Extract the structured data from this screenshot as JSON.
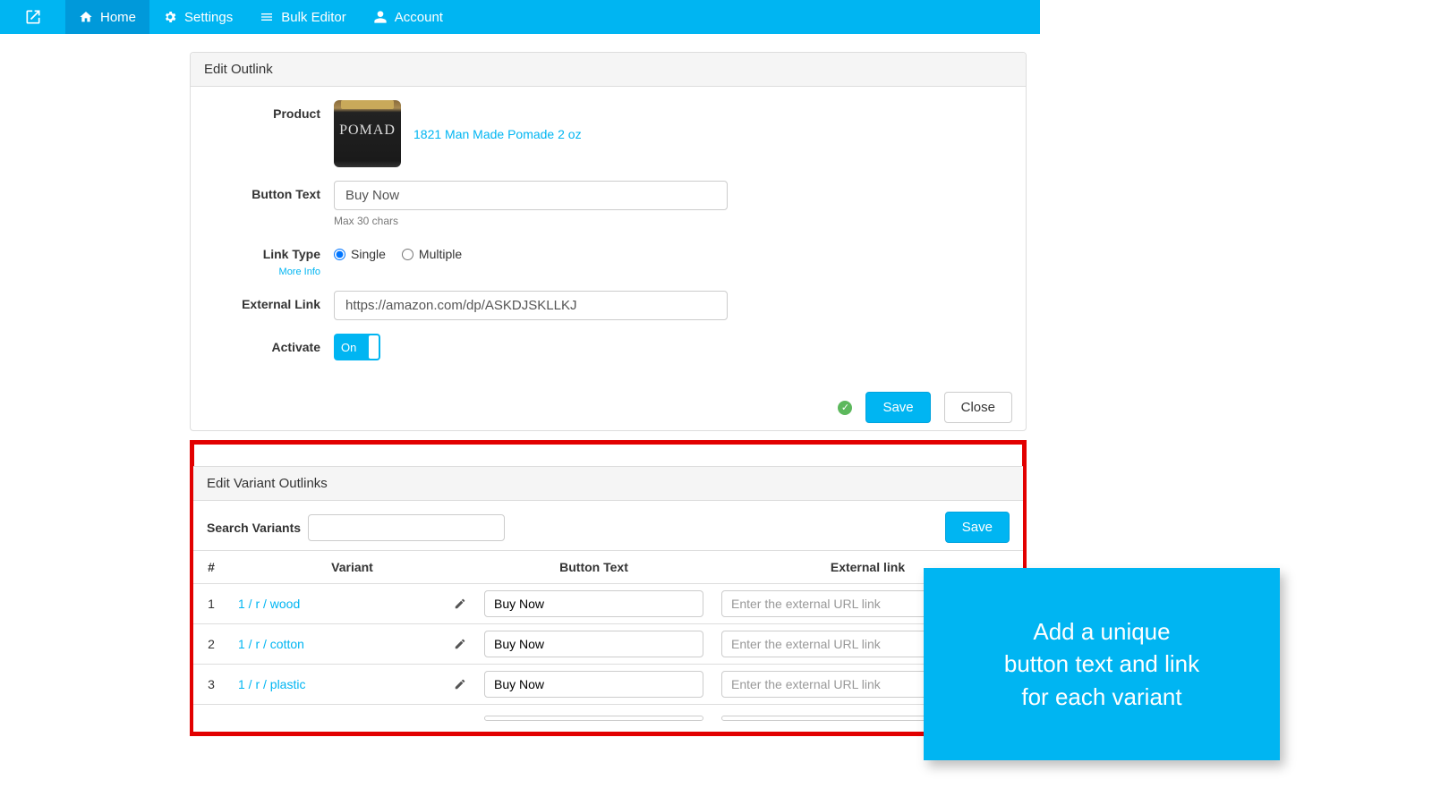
{
  "nav": {
    "home": "Home",
    "settings": "Settings",
    "bulk_editor": "Bulk Editor",
    "account": "Account"
  },
  "panel1": {
    "title": "Edit Outlink",
    "labels": {
      "product": "Product",
      "button_text": "Button Text",
      "link_type": "Link Type",
      "external_link": "External Link",
      "activate": "Activate"
    },
    "product_name": "1821 Man Made Pomade 2 oz",
    "button_text_value": "Buy Now",
    "button_text_help": "Max 30 chars",
    "link_type_single": "Single",
    "link_type_multiple": "Multiple",
    "more_info": "More Info",
    "external_link_value": "https://amazon.com/dp/ASKDJSKLLKJ",
    "activate_state": "On",
    "save": "Save",
    "close": "Close"
  },
  "panel2": {
    "title": "Edit Variant Outlinks",
    "search_label": "Search Variants",
    "save": "Save",
    "headers": {
      "num": "#",
      "variant": "Variant",
      "button_text": "Button Text",
      "external_link": "External link"
    },
    "rows": [
      {
        "n": "1",
        "variant": "1 / r / wood",
        "btn": "Buy Now",
        "ext_ph": "Enter the external URL link"
      },
      {
        "n": "2",
        "variant": "1 / r / cotton",
        "btn": "Buy Now",
        "ext_ph": "Enter the external URL link"
      },
      {
        "n": "3",
        "variant": "1 / r / plastic",
        "btn": "Buy Now",
        "ext_ph": "Enter the external URL link"
      }
    ]
  },
  "callout": {
    "line1": "Add a unique",
    "line2": "button text and link",
    "line3": "for each variant"
  }
}
